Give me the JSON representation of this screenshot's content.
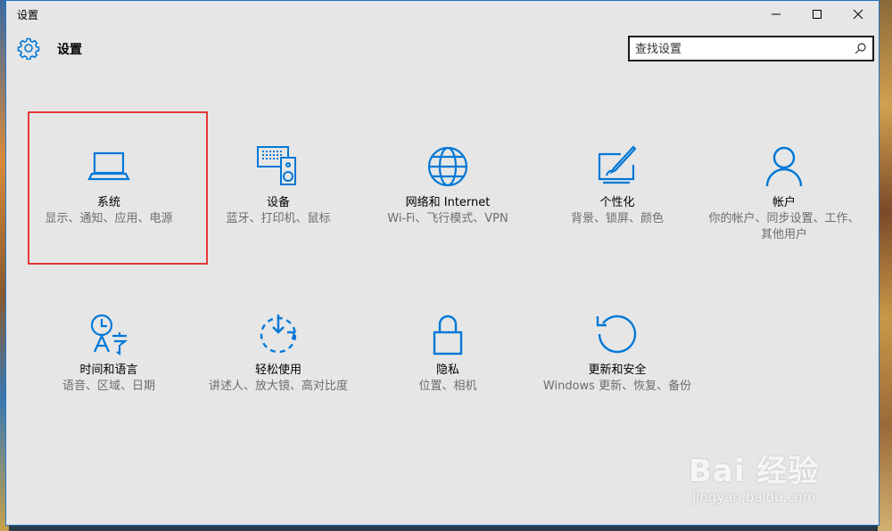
{
  "window": {
    "title": "设置"
  },
  "header": {
    "app_title": "设置",
    "search_placeholder": "查找设置"
  },
  "tiles": [
    {
      "id": "system",
      "icon": "laptop-icon",
      "name": "系统",
      "desc": "显示、通知、应用、电源"
    },
    {
      "id": "devices",
      "icon": "devices-icon",
      "name": "设备",
      "desc": "蓝牙、打印机、鼠标"
    },
    {
      "id": "network",
      "icon": "globe-icon",
      "name": "网络和 Internet",
      "desc": "Wi-Fi、飞行模式、VPN"
    },
    {
      "id": "personalization",
      "icon": "personalization-icon",
      "name": "个性化",
      "desc": "背景、锁屏、颜色"
    },
    {
      "id": "accounts",
      "icon": "person-icon",
      "name": "帐户",
      "desc": "你的帐户、同步设置、工作、其他用户"
    },
    {
      "id": "time-language",
      "icon": "time-language-icon",
      "name": "时间和语言",
      "desc": "语音、区域、日期"
    },
    {
      "id": "ease-of-access",
      "icon": "ease-of-access-icon",
      "name": "轻松使用",
      "desc": "讲述人、放大镜、高对比度"
    },
    {
      "id": "privacy",
      "icon": "lock-icon",
      "name": "隐私",
      "desc": "位置、相机"
    },
    {
      "id": "update-security",
      "icon": "update-icon",
      "name": "更新和安全",
      "desc": "Windows 更新、恢复、备份"
    }
  ],
  "watermark": {
    "brand": "Bai 经验",
    "url": "jingyan.baidu.com"
  },
  "colors": {
    "accent": "#0078d7",
    "highlight_border": "#e53935",
    "window_bg": "#e6e6e6"
  }
}
